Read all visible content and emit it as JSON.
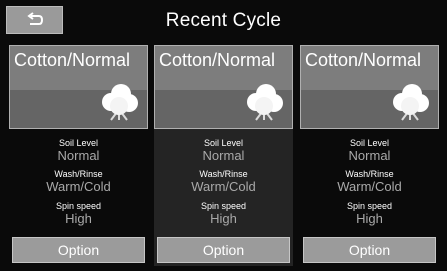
{
  "header": {
    "title": "Recent Cycle",
    "back_icon": "back-arrow-icon"
  },
  "cards": [
    {
      "cycle": "Cotton/Normal",
      "image_icon": "cotton-icon",
      "soil_label": "Soil Level",
      "soil_value": "Normal",
      "temp_label": "Wash/Rinse",
      "temp_value": "Warm/Cold",
      "spin_label": "Spin speed",
      "spin_value": "High",
      "option_label": "Option"
    },
    {
      "cycle": "Cotton/Normal",
      "image_icon": "cotton-icon",
      "soil_label": "Soil Level",
      "soil_value": "Normal",
      "temp_label": "Wash/Rinse",
      "temp_value": "Warm/Cold",
      "spin_label": "Spin speed",
      "spin_value": "High",
      "option_label": "Option"
    },
    {
      "cycle": "Cotton/Normal",
      "image_icon": "cotton-icon",
      "soil_label": "Soil Level",
      "soil_value": "Normal",
      "temp_label": "Wash/Rinse",
      "temp_value": "Warm/Cold",
      "spin_label": "Spin speed",
      "spin_value": "High",
      "option_label": "Option"
    }
  ]
}
